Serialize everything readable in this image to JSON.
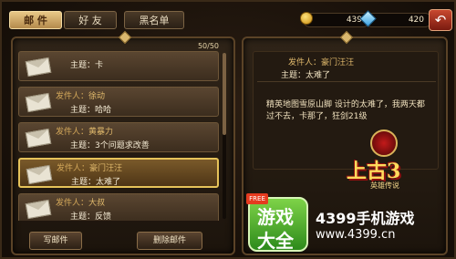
{
  "tabs": [
    {
      "label": "邮 件",
      "active": true
    },
    {
      "label": "好 友",
      "active": false
    },
    {
      "label": "黑名单",
      "active": false
    }
  ],
  "resources": {
    "gold": "439",
    "gems": "420"
  },
  "mail_list": {
    "counter": "50/50",
    "sender_label": "发件人：",
    "subject_label": "主题：",
    "items": [
      {
        "sender": "",
        "subject": "卡",
        "selected": false
      },
      {
        "sender": "徐动",
        "subject": "哈哈",
        "selected": false
      },
      {
        "sender": "黄暴力",
        "subject": "3个问题求改善",
        "selected": false
      },
      {
        "sender": "豪门汪汪",
        "subject": "太难了",
        "selected": true
      },
      {
        "sender": "大叔",
        "subject": "反馈",
        "selected": false
      }
    ],
    "write_button": "写邮件",
    "delete_button": "删除邮件"
  },
  "detail": {
    "sender_label": "发件人：",
    "sender": "豪门汪汪",
    "subject_label": "主题：",
    "subject": "太难了",
    "body": "精英地图雪原山脚 设计的太难了，我两天都过不去，卡那了，狂剑21级"
  },
  "overlay": {
    "game_logo": "上古3",
    "game_logo_sub": "英雄传说",
    "ad_line1": "游戏",
    "ad_line2": "大全",
    "ad_free": "FREE",
    "ad_title": "4399手机游戏",
    "ad_url": "www.4399.cn"
  },
  "colors": {
    "accent_gold": "#e6c35a",
    "panel_bg": "#2f2418",
    "back_button": "#c8482f"
  }
}
